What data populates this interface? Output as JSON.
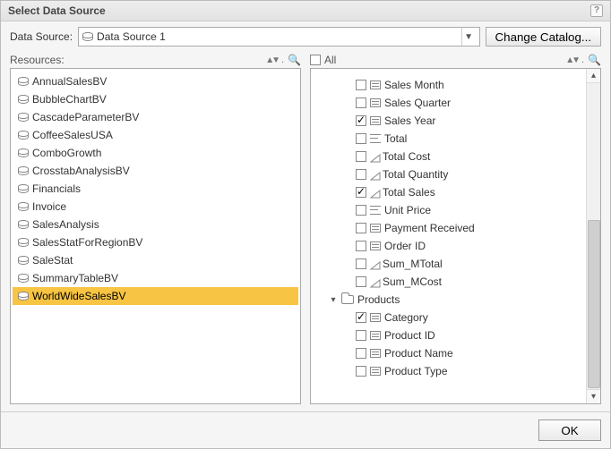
{
  "dialog": {
    "title": "Select Data Source"
  },
  "dataSource": {
    "label": "Data Source:",
    "selected": "Data Source 1",
    "changeCatalog": "Change Catalog..."
  },
  "resourcesPanel": {
    "label": "Resources:",
    "items": [
      {
        "name": "AnnualSalesBV"
      },
      {
        "name": "BubbleChartBV"
      },
      {
        "name": "CascadeParameterBV"
      },
      {
        "name": "CoffeeSalesUSA"
      },
      {
        "name": "ComboGrowth"
      },
      {
        "name": "CrosstabAnalysisBV"
      },
      {
        "name": "Financials"
      },
      {
        "name": "Invoice"
      },
      {
        "name": "SalesAnalysis"
      },
      {
        "name": "SalesStatForRegionBV"
      },
      {
        "name": "SaleStat"
      },
      {
        "name": "SummaryTableBV"
      },
      {
        "name": "WorldWideSalesBV",
        "selected": true
      }
    ]
  },
  "fieldsPanel": {
    "allLabel": "All",
    "fields": [
      {
        "label": "Sales Month",
        "type": "lines",
        "checked": false,
        "level": 2
      },
      {
        "label": "Sales Quarter",
        "type": "lines",
        "checked": false,
        "level": 2
      },
      {
        "label": "Sales Year",
        "type": "lines",
        "checked": true,
        "level": 2
      },
      {
        "label": "Total",
        "type": "sum",
        "checked": false,
        "level": 2
      },
      {
        "label": "Total Cost",
        "type": "tri",
        "checked": false,
        "level": 2
      },
      {
        "label": "Total Quantity",
        "type": "tri",
        "checked": false,
        "level": 2
      },
      {
        "label": "Total Sales",
        "type": "tri",
        "checked": true,
        "level": 2
      },
      {
        "label": "Unit Price",
        "type": "sum",
        "checked": false,
        "level": 2
      },
      {
        "label": "Payment Received",
        "type": "lines",
        "checked": false,
        "level": 2
      },
      {
        "label": "Order ID",
        "type": "lines",
        "checked": false,
        "level": 2
      },
      {
        "label": "Sum_MTotal",
        "type": "tri",
        "checked": false,
        "level": 2
      },
      {
        "label": "Sum_MCost",
        "type": "tri",
        "checked": false,
        "level": 2
      }
    ],
    "productsGroup": {
      "label": "Products",
      "expanded": true,
      "children": [
        {
          "label": "Category",
          "type": "lines",
          "checked": true
        },
        {
          "label": "Product ID",
          "type": "lines",
          "checked": false
        },
        {
          "label": "Product Name",
          "type": "lines",
          "checked": false
        },
        {
          "label": "Product Type",
          "type": "lines",
          "checked": false
        }
      ]
    }
  },
  "footer": {
    "ok": "OK"
  }
}
